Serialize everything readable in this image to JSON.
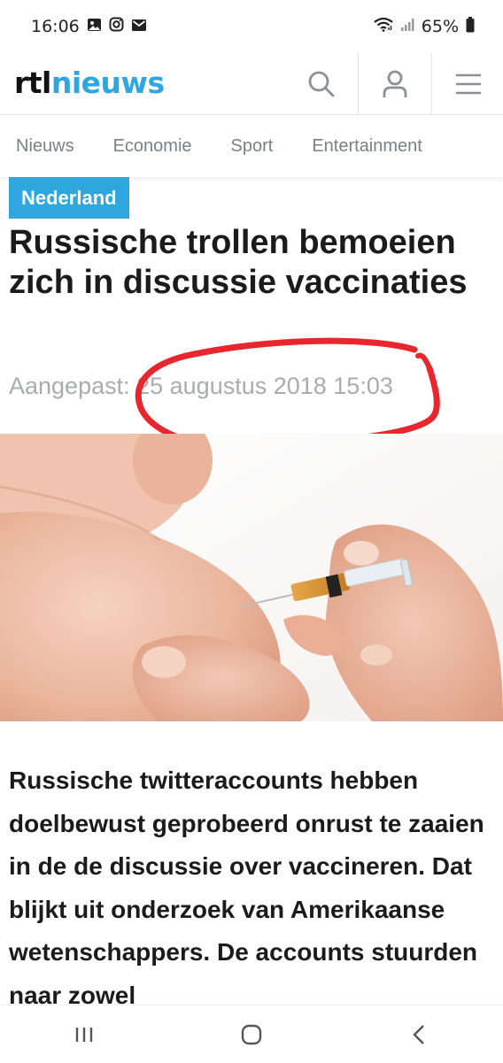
{
  "status_bar": {
    "time": "16:06",
    "battery": "65%",
    "left_icons": [
      "image-icon",
      "instagram-icon",
      "mail-icon"
    ],
    "right_icons": [
      "wifi-icon",
      "signal-icon",
      "battery-icon"
    ]
  },
  "header": {
    "logo_part1": "rtl",
    "logo_part2": "nieuws",
    "icons": [
      "search-icon",
      "account-icon",
      "menu-icon"
    ]
  },
  "nav": {
    "items": [
      {
        "label": "Nieuws"
      },
      {
        "label": "Economie"
      },
      {
        "label": "Sport"
      },
      {
        "label": "Entertainment"
      }
    ]
  },
  "article": {
    "category": "Nederland",
    "title": "Russische trollen bemoeien zich in discussie vaccinaties",
    "meta": "Aangepast: 25 augustus 2018 15:03",
    "lead": "Russische twitteraccounts hebben doelbewust geprobeerd onrust te zaaien in de de discussie over vaccineren. Dat blijkt uit onderzoek van Amerikaanse wetenschappers. De accounts stuurden naar zowel"
  },
  "colors": {
    "brand_blue": "#2fa6de",
    "annotation_red": "#e8262e",
    "nav_text": "#7a8086",
    "meta_text": "#a9abad"
  },
  "bottom_nav": {
    "icons": [
      "recent-apps-icon",
      "home-icon",
      "back-icon"
    ]
  }
}
